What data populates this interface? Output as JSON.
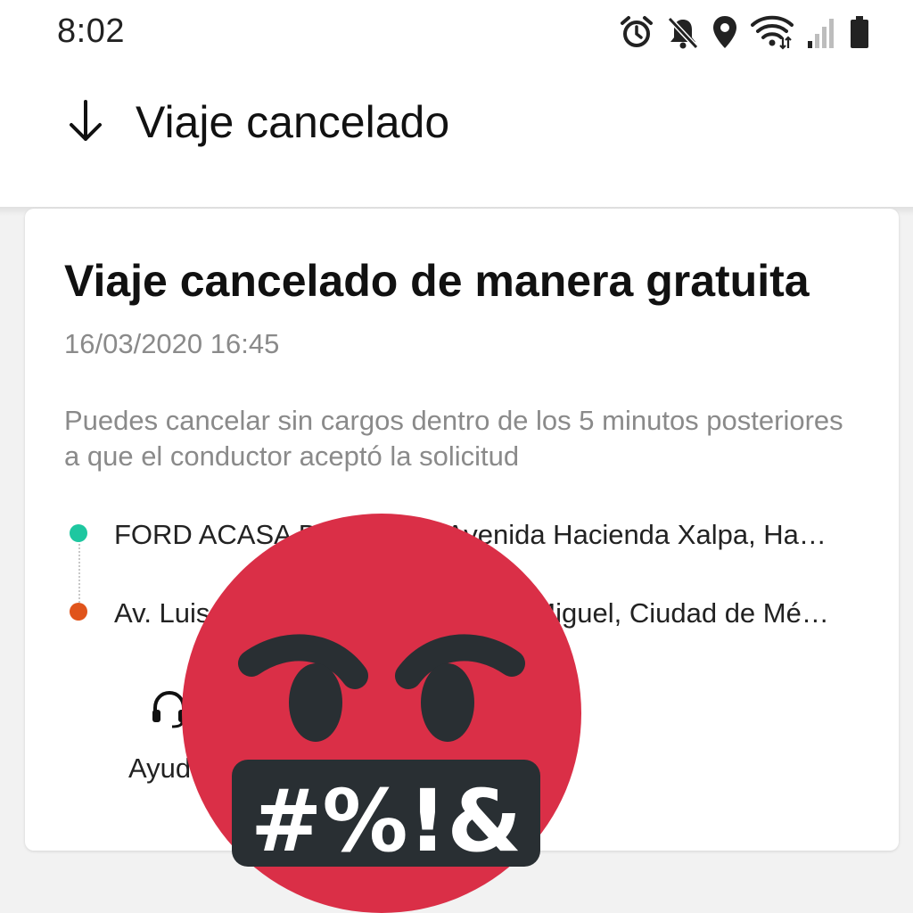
{
  "status_bar": {
    "time": "8:02",
    "icons": [
      "alarm-icon",
      "mute-icon",
      "location-icon",
      "wifi-icon",
      "signal-icon",
      "battery-icon"
    ]
  },
  "app_bar": {
    "back_icon": "arrow-down-icon",
    "title": "Viaje cancelado"
  },
  "card": {
    "title": "Viaje cancelado de manera gratuita",
    "date": "16/03/2020 16:45",
    "note": "Puedes cancelar sin cargos dentro de los 5 minutos posteriores a que el conductor aceptó la solicitud",
    "origin": "FORD ACASA DE México, Avenida Hacienda Xalpa, Ha…",
    "destination": "Av. Luis Barragán, Lomas de San Miguel, Ciudad de Mé…",
    "help_label": "Ayuda"
  },
  "overlay": {
    "icon": "angry-cursing-face-icon",
    "symbols": "#%!&"
  },
  "colors": {
    "origin_dot": "#1ec7a0",
    "destination_dot": "#e0541b",
    "secondary_text": "#8a8a8a",
    "emoji_red": "#da2f47",
    "emoji_dark": "#292f33"
  }
}
